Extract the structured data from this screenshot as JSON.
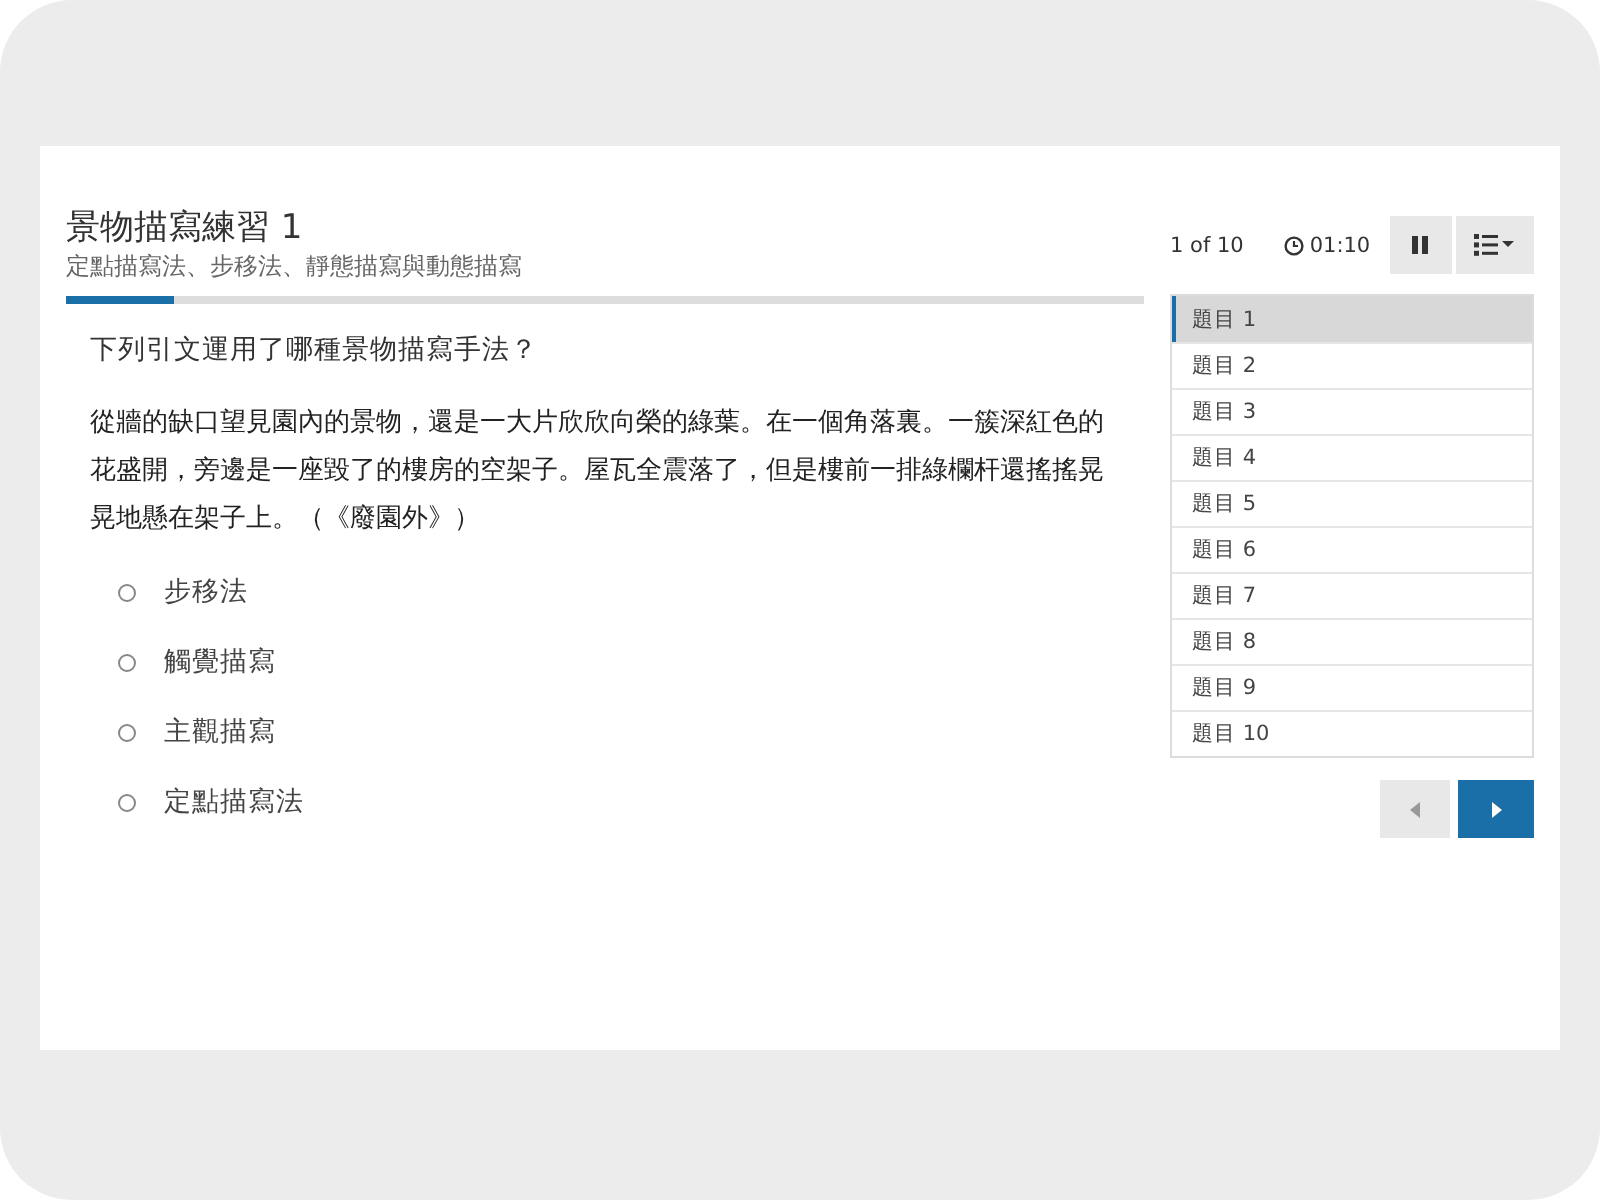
{
  "quiz": {
    "title": "景物描寫練習 1",
    "subtitle": "定點描寫法、步移法、靜態描寫與動態描寫",
    "progress": {
      "level": 0.1
    }
  },
  "question": {
    "prompt": "下列引文運用了哪種景物描寫手法？",
    "passage": "從牆的缺口望見園內的景物，還是一大片欣欣向榮的綠葉。在一個角落裏。一簇深紅色的花盛開，旁邊是一座毀了的樓房的空架子。屋瓦全震落了，但是樓前一排綠欄杆還搖搖晃晃地懸在架子上。（《廢園外》）",
    "options": [
      {
        "label": "步移法",
        "selected": false
      },
      {
        "label": "觸覺描寫",
        "selected": false
      },
      {
        "label": "主觀描寫",
        "selected": false
      },
      {
        "label": "定點描寫法",
        "selected": false
      }
    ]
  },
  "toolbar": {
    "counter": "1 of 10",
    "timer": "01:10"
  },
  "question_list": [
    {
      "label": "題目 1",
      "selected": true
    },
    {
      "label": "題目 2",
      "selected": false
    },
    {
      "label": "題目 3",
      "selected": false
    },
    {
      "label": "題目 4",
      "selected": false
    },
    {
      "label": "題目 5",
      "selected": false
    },
    {
      "label": "題目 6",
      "selected": false
    },
    {
      "label": "題目 7",
      "selected": false
    },
    {
      "label": "題目 8",
      "selected": false
    },
    {
      "label": "題目 9",
      "selected": false
    },
    {
      "label": "題目 10",
      "selected": false
    }
  ]
}
